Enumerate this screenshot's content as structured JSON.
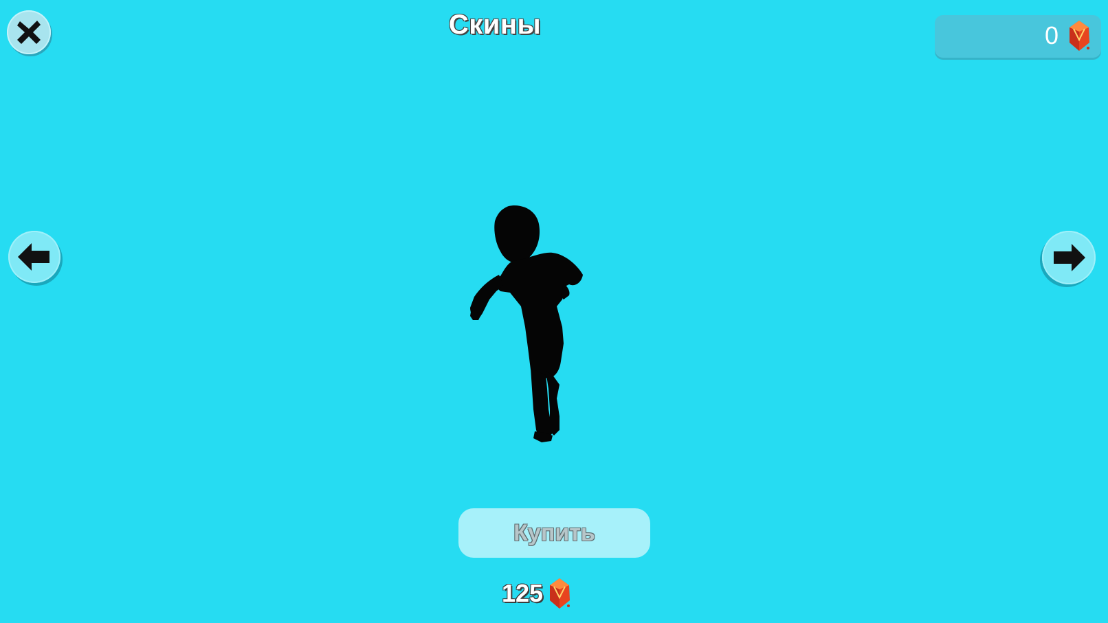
{
  "header": {
    "title": "Скины",
    "close_icon": "close-icon"
  },
  "currency": {
    "balance": "0",
    "icon": "red-gem-icon"
  },
  "navigation": {
    "prev_icon": "arrow-left-icon",
    "next_icon": "arrow-right-icon"
  },
  "skin": {
    "locked": true,
    "preview": "character-silhouette"
  },
  "purchase": {
    "buy_label": "Купить",
    "price": "125",
    "price_icon": "red-gem-icon"
  },
  "colors": {
    "background": "#26dcf2",
    "button": "#7fe9f6",
    "buy_button": "#a7f1fa",
    "gem": "#e8441f"
  }
}
